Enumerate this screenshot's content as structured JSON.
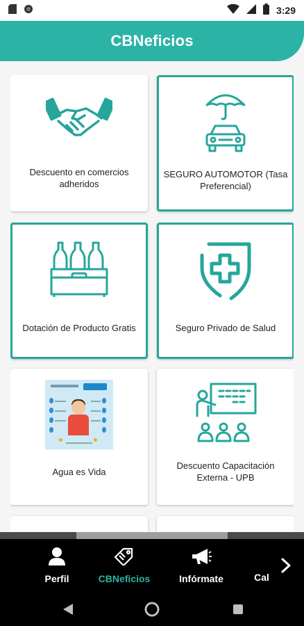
{
  "status_bar": {
    "time": "3:29",
    "icons": [
      "sd-card-icon",
      "circle-status-icon",
      "wifi-icon",
      "signal-icon",
      "battery-icon"
    ]
  },
  "header": {
    "title": "CBNeficios",
    "color": "#2bb3a6"
  },
  "cards": [
    {
      "label": "Descuento en comercios\nadheridos",
      "icon": "handshake-icon",
      "highlighted": false
    },
    {
      "label": "SEGURO AUTOMOTOR (Tasa\nPreferencial)",
      "icon": "car-umbrella-icon",
      "highlighted": true
    },
    {
      "label": "Dotación de Producto Gratis",
      "icon": "bottle-crate-icon",
      "highlighted": true
    },
    {
      "label": "Seguro Privado de Salud",
      "icon": "health-shield-icon",
      "highlighted": true
    },
    {
      "label": "Agua es Vida",
      "icon": "water-infographic-image",
      "highlighted": false
    },
    {
      "label": "Descuento Capacitación\nExterna - UPB",
      "icon": "training-board-icon",
      "highlighted": false
    }
  ],
  "bottom_nav": {
    "items": [
      {
        "label": "Perfil",
        "icon": "person-icon",
        "active": false
      },
      {
        "label": "CBNeficios",
        "icon": "tags-icon",
        "active": true
      },
      {
        "label": "Infórmate",
        "icon": "megaphone-icon",
        "active": false
      },
      {
        "label": "Cal",
        "icon": "",
        "active": false
      }
    ],
    "more_icon": "chevron-right-icon",
    "active_color": "#2bb3a6"
  },
  "system_nav": [
    "back-icon",
    "home-icon",
    "recents-icon"
  ]
}
